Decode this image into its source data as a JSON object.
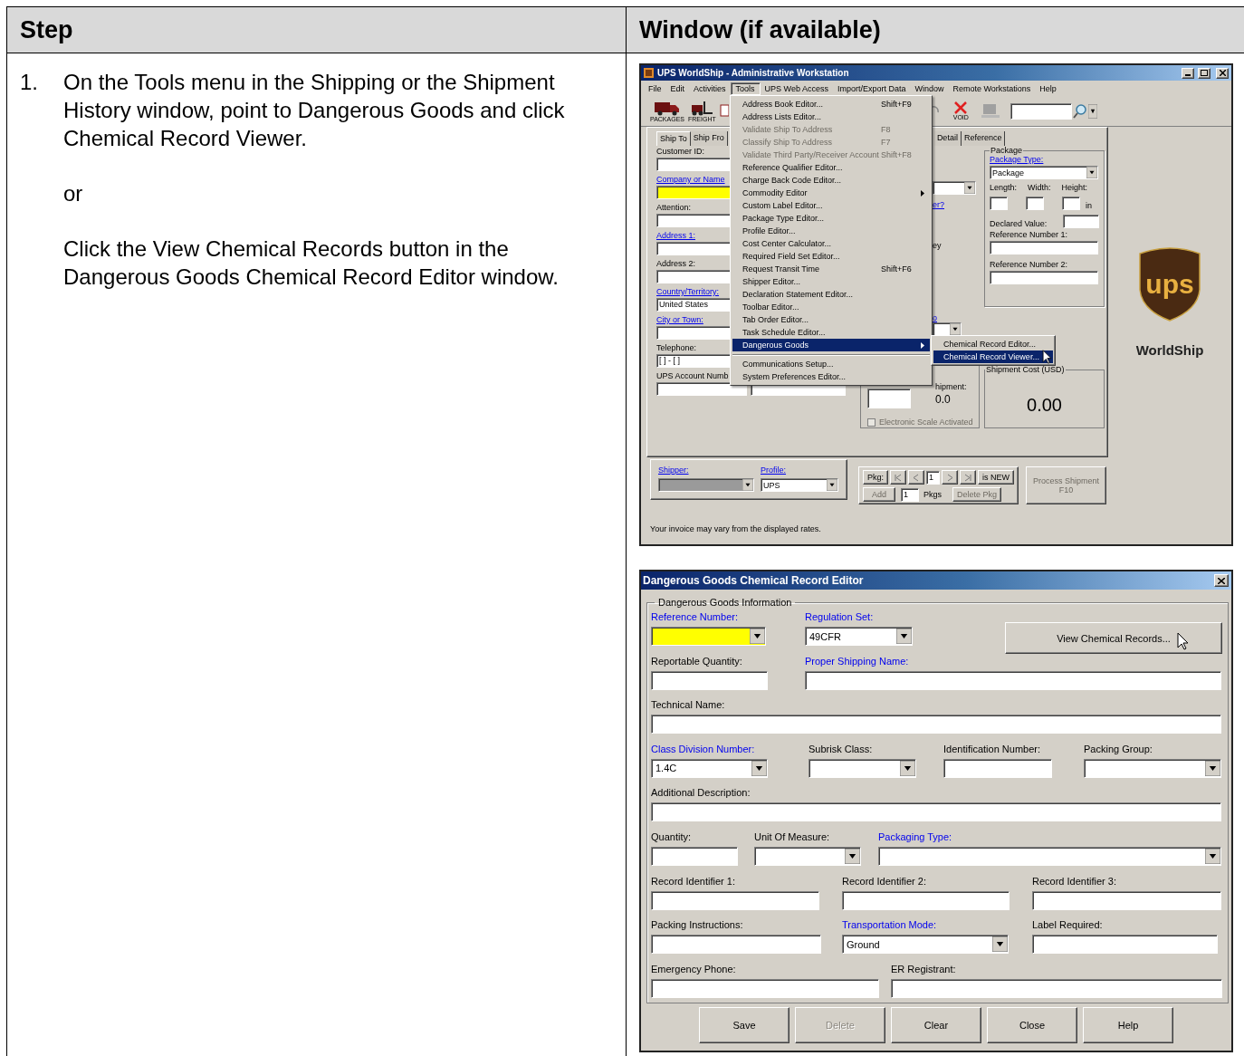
{
  "table": {
    "columns": [
      "Step",
      "Window (if available)"
    ]
  },
  "step": {
    "number": "1.",
    "paragraphs": [
      "On the Tools menu in the Shipping or the Shipment History window, point to Dangerous Goods and click Chemical Record Viewer.",
      "or",
      "Click the View Chemical Records button in the Dangerous Goods Chemical Record Editor window."
    ]
  },
  "worldship": {
    "title": "UPS WorldShip - Administrative Workstation",
    "menubar": [
      {
        "label": "File",
        "selected": false
      },
      {
        "label": "Edit",
        "selected": false
      },
      {
        "label": "Activities",
        "selected": false
      },
      {
        "label": "Tools",
        "selected": true
      },
      {
        "label": "UPS Web Access",
        "selected": false
      },
      {
        "label": "Import/Export Data",
        "selected": false
      },
      {
        "label": "Window",
        "selected": false
      },
      {
        "label": "Remote Workstations",
        "selected": false
      },
      {
        "label": "Help",
        "selected": false
      }
    ],
    "toolbar": [
      {
        "kind": "packages",
        "label": "PACKAGES"
      },
      {
        "kind": "freight",
        "label": "FREIGHT"
      },
      {
        "kind": "void",
        "label": "VOID"
      }
    ],
    "tabs": [
      {
        "label": "Ship To",
        "selected": true
      },
      {
        "label": "Ship Fro",
        "selected": false
      },
      {
        "label": "Detail",
        "selected": false
      },
      {
        "label": "Reference",
        "selected": false
      }
    ],
    "ship_to_fields": [
      {
        "kind": "text",
        "label": "Customer ID:",
        "required": false,
        "highlight": false
      },
      {
        "kind": "text",
        "label": "Company or Name",
        "required": true,
        "highlight": true
      },
      {
        "kind": "text",
        "label": "Attention:",
        "required": false,
        "highlight": false
      },
      {
        "kind": "text",
        "label": "Address 1:",
        "required": true,
        "highlight": false
      },
      {
        "kind": "text",
        "label": "Address 2:",
        "required": false,
        "highlight": false
      },
      {
        "kind": "text",
        "label": "Country/Territory:",
        "required": true,
        "highlight": false,
        "value": "United States"
      },
      {
        "kind": "text",
        "label": "City or Town:",
        "required": true,
        "highlight": false
      },
      {
        "kind": "text",
        "label": "Telephone:",
        "required": false,
        "highlight": false,
        "value": "[ ]  -  [ ]"
      },
      {
        "kind": "pair",
        "label": "UPS Account Numb",
        "required": false,
        "highlight": false
      }
    ],
    "fragments": [
      {
        "label": "er?",
        "required": true
      },
      {
        "label": "ey",
        "required": false
      },
      {
        "label": "o",
        "required": true
      }
    ],
    "package": {
      "legend": "Package",
      "type_label": "Package Type:",
      "type_value": "Package",
      "dims": [
        "Length:",
        "Width:",
        "Height:"
      ],
      "unit": "in",
      "declared_label": "Declared Value:",
      "refs": [
        "Reference Number 1:",
        "Reference Number 2:"
      ]
    },
    "weight": {
      "label": "hipment:",
      "value": "0.0",
      "scale_label": "Electronic Scale Activated",
      "scale_checked": false,
      "scale_disabled": true
    },
    "cost": {
      "legend": "Shipment Cost (USD)",
      "value": "0.00"
    },
    "shipper": {
      "label": "Shipper:",
      "profile_label": "Profile:",
      "profile_value": "UPS"
    },
    "pkg_nav": {
      "label": "Pkg:",
      "current": "1",
      "status": "is NEW",
      "add": "Add",
      "add_disabled": true,
      "count": "1",
      "count_label": "Pkgs",
      "delete": "Delete Pkg",
      "delete_disabled": true
    },
    "process_button": {
      "lines": [
        "Process Shipment",
        "F10"
      ],
      "disabled": true
    },
    "status": "Your invoice may vary from the displayed rates.",
    "logo": {
      "mark": "ups",
      "product": "WorldShip"
    },
    "tools_menu": [
      {
        "kind": "item",
        "label": "Address Book Editor...",
        "shortcut": "Shift+F9",
        "disabled": false,
        "selected": false,
        "submenu": false
      },
      {
        "kind": "item",
        "label": "Address Lists Editor...",
        "disabled": false,
        "selected": false,
        "submenu": false
      },
      {
        "kind": "item",
        "label": "Validate Ship To Address",
        "shortcut": "F8",
        "disabled": true,
        "selected": false,
        "submenu": false
      },
      {
        "kind": "item",
        "label": "Classify Ship To Address",
        "shortcut": "F7",
        "disabled": true,
        "selected": false,
        "submenu": false
      },
      {
        "kind": "item",
        "label": "Validate Third Party/Receiver Account",
        "shortcut": "Shift+F8",
        "disabled": true,
        "selected": false,
        "submenu": false
      },
      {
        "kind": "item",
        "label": "Reference Qualifier Editor...",
        "disabled": false,
        "selected": false,
        "submenu": false
      },
      {
        "kind": "item",
        "label": "Charge Back Code Editor...",
        "disabled": false,
        "selected": false,
        "submenu": false
      },
      {
        "kind": "item",
        "label": "Commodity Editor",
        "disabled": false,
        "selected": false,
        "submenu": true
      },
      {
        "kind": "item",
        "label": "Custom Label Editor...",
        "disabled": false,
        "selected": false,
        "submenu": false
      },
      {
        "kind": "item",
        "label": "Package Type Editor...",
        "disabled": false,
        "selected": false,
        "submenu": false
      },
      {
        "kind": "item",
        "label": "Profile Editor...",
        "disabled": false,
        "selected": false,
        "submenu": false
      },
      {
        "kind": "item",
        "label": "Cost Center Calculator...",
        "disabled": false,
        "selected": false,
        "submenu": false
      },
      {
        "kind": "item",
        "label": "Required Field Set Editor...",
        "disabled": false,
        "selected": false,
        "submenu": false
      },
      {
        "kind": "item",
        "label": "Request Transit Time",
        "shortcut": "Shift+F6",
        "disabled": false,
        "selected": false,
        "submenu": false
      },
      {
        "kind": "item",
        "label": "Shipper Editor...",
        "disabled": false,
        "selected": false,
        "submenu": false
      },
      {
        "kind": "item",
        "label": "Declaration Statement Editor...",
        "disabled": false,
        "selected": false,
        "submenu": false
      },
      {
        "kind": "item",
        "label": "Toolbar Editor...",
        "disabled": false,
        "selected": false,
        "submenu": false
      },
      {
        "kind": "item",
        "label": "Tab Order Editor...",
        "disabled": false,
        "selected": false,
        "submenu": false
      },
      {
        "kind": "item",
        "label": "Task Schedule Editor...",
        "disabled": false,
        "selected": false,
        "submenu": false
      },
      {
        "kind": "item",
        "label": "Dangerous Goods",
        "disabled": false,
        "selected": true,
        "submenu": true
      },
      {
        "kind": "separator"
      },
      {
        "kind": "item",
        "label": "Communications Setup...",
        "disabled": false,
        "selected": false,
        "submenu": false
      },
      {
        "kind": "item",
        "label": "System Preferences Editor...",
        "disabled": false,
        "selected": false,
        "submenu": false
      }
    ],
    "submenu": [
      {
        "label": "Chemical Record Editor...",
        "selected": false
      },
      {
        "label": "Chemical Record Viewer...",
        "selected": true
      }
    ]
  },
  "dg_editor": {
    "title": "Dangerous Goods Chemical Record Editor",
    "group": "Dangerous Goods Information",
    "rows": [
      [
        {
          "kind": "dropdown",
          "label": "Reference Number:",
          "required": true,
          "highlight": true
        },
        {
          "kind": "dropdown",
          "label": "Regulation Set:",
          "required": true,
          "highlight": false,
          "value": "49CFR"
        },
        {
          "kind": "button",
          "label": "View Chemical Records..."
        }
      ],
      [
        {
          "kind": "text",
          "label": "Reportable Quantity:",
          "required": false,
          "highlight": false
        },
        {
          "kind": "text",
          "label": "Proper Shipping Name:",
          "required": true,
          "highlight": false
        }
      ],
      [
        {
          "kind": "text",
          "label": "Technical Name:",
          "required": false,
          "highlight": false
        }
      ],
      [
        {
          "kind": "dropdown",
          "label": "Class Division Number:",
          "required": true,
          "highlight": false,
          "value": "1.4C"
        },
        {
          "kind": "dropdown",
          "label": "Subrisk Class:",
          "required": false,
          "highlight": false
        },
        {
          "kind": "text",
          "label": "Identification Number:",
          "required": false,
          "highlight": false
        },
        {
          "kind": "dropdown",
          "label": "Packing Group:",
          "required": false,
          "highlight": false
        }
      ],
      [
        {
          "kind": "text",
          "label": "Additional Description:",
          "required": false,
          "highlight": false
        }
      ],
      [
        {
          "kind": "text",
          "label": "Quantity:",
          "required": false,
          "highlight": false
        },
        {
          "kind": "dropdown",
          "label": "Unit Of Measure:",
          "required": false,
          "highlight": false
        },
        {
          "kind": "dropdown",
          "label": "Packaging Type:",
          "required": true,
          "highlight": false
        }
      ],
      [
        {
          "kind": "text",
          "label": "Record Identifier 1:",
          "required": false,
          "highlight": false
        },
        {
          "kind": "text",
          "label": "Record Identifier 2:",
          "required": false,
          "highlight": false
        },
        {
          "kind": "text",
          "label": "Record Identifier 3:",
          "required": false,
          "highlight": false
        }
      ],
      [
        {
          "kind": "text",
          "label": "Packing Instructions:",
          "required": false,
          "highlight": false
        },
        {
          "kind": "dropdown",
          "label": "Transportation Mode:",
          "required": true,
          "highlight": false,
          "value": "Ground"
        },
        {
          "kind": "text",
          "label": "Label Required:",
          "required": false,
          "highlight": false
        }
      ],
      [
        {
          "kind": "text",
          "label": "Emergency Phone:",
          "required": false,
          "highlight": false
        },
        {
          "kind": "text",
          "label": "ER Registrant:",
          "required": false,
          "highlight": false
        }
      ]
    ],
    "buttons": [
      {
        "label": "Save",
        "disabled": false
      },
      {
        "label": "Delete",
        "disabled": true
      },
      {
        "label": "Clear",
        "disabled": false
      },
      {
        "label": "Close",
        "disabled": false
      },
      {
        "label": "Help",
        "disabled": false
      }
    ]
  }
}
